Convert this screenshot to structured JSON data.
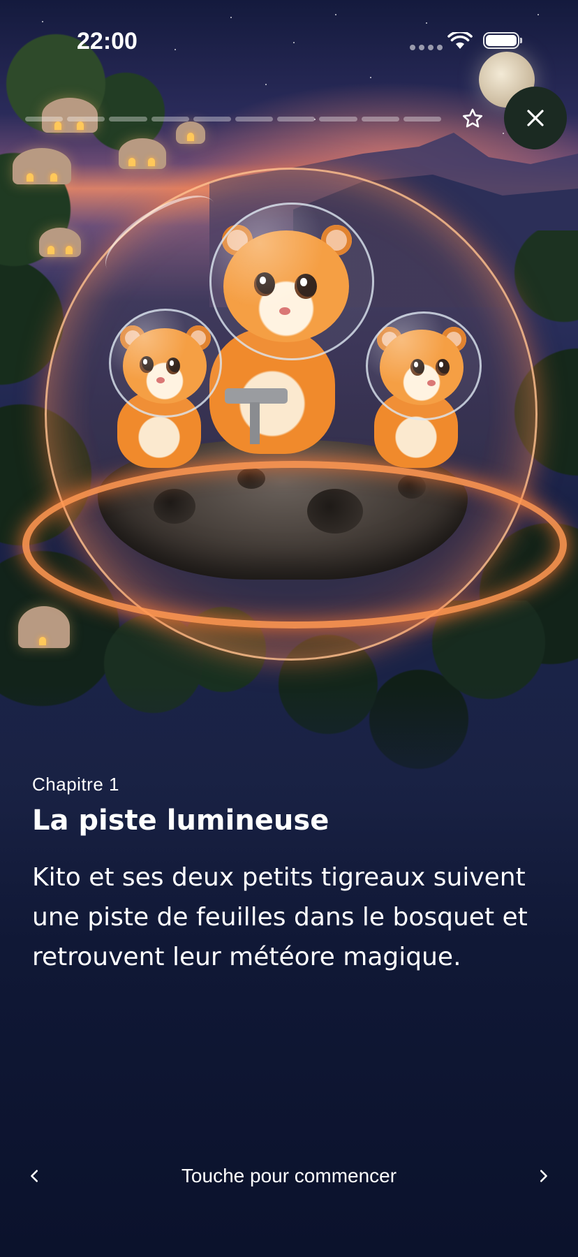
{
  "status_bar": {
    "time": "22:00",
    "signal_icon": "cellular-dots-icon",
    "wifi_icon": "wifi-icon",
    "battery_icon": "battery-icon",
    "battery_level": 1.0
  },
  "header": {
    "progress": {
      "total_segments": 10,
      "completed_segments": 0
    },
    "favorite_icon": "star-outline-icon",
    "close_icon": "close-icon"
  },
  "illustration": {
    "name": "illustration-tigers-meteor-bubble"
  },
  "story": {
    "chapter": "Chapitre 1",
    "title": "La piste lumineuse",
    "description": "Kito et ses deux petits tigreaux suivent une piste de feuilles dans le bosquet et retrouvent leur météore magique."
  },
  "footer": {
    "prev_icon": "chevron-left-icon",
    "next_icon": "chevron-right-icon",
    "start_label": "Touche pour commencer"
  },
  "colors": {
    "close_button_bg": "#1b2a22",
    "background_dark": "#0b1328",
    "glow_orange": "#ff8a4c"
  }
}
